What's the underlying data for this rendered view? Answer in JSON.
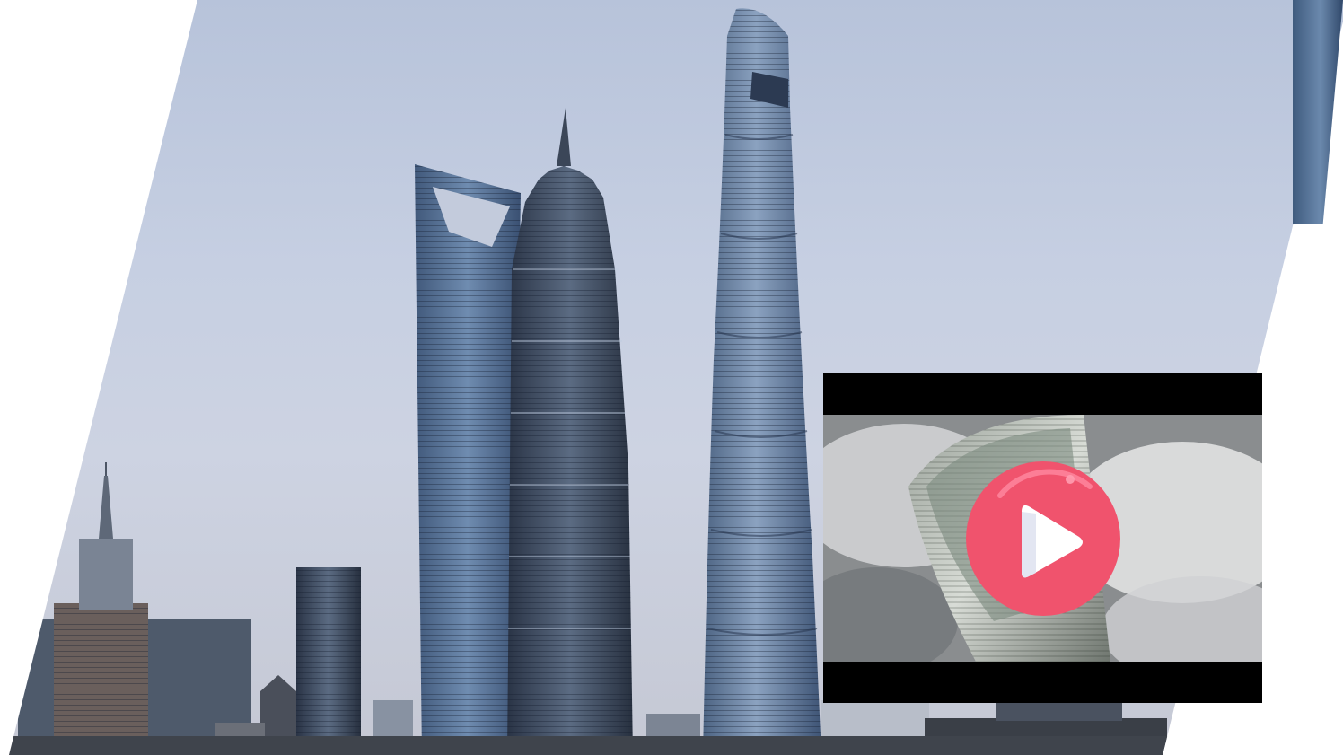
{
  "scene": {
    "description_free": true,
    "palette": {
      "sky_top": "#b7c3da",
      "sky_bottom": "#c5c8d4",
      "glass_blue": "#5d7599",
      "glass_dark": "#2f3f55",
      "play_accent": "#f0536d",
      "play_highlight": "#ff8aa0"
    }
  },
  "video": {
    "play_icon": "play-icon",
    "state": "paused"
  }
}
